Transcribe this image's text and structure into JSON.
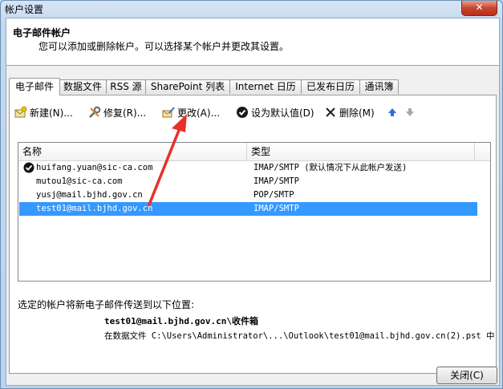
{
  "window": {
    "title": "帐户设置",
    "close_glyph": "✕"
  },
  "header": {
    "title": "电子邮件帐户",
    "description": "您可以添加或删除帐户。可以选择某个帐户并更改其设置。"
  },
  "tabs": [
    {
      "label": "电子邮件",
      "active": true
    },
    {
      "label": "数据文件",
      "active": false
    },
    {
      "label": "RSS 源",
      "active": false
    },
    {
      "label": "SharePoint 列表",
      "active": false
    },
    {
      "label": "Internet 日历",
      "active": false
    },
    {
      "label": "已发布日历",
      "active": false
    },
    {
      "label": "通讯簿",
      "active": false
    }
  ],
  "toolbar": {
    "new_label": "新建(N)...",
    "repair_label": "修复(R)...",
    "change_label": "更改(A)...",
    "default_label": "设为默认值(D)",
    "delete_label": "删除(M)"
  },
  "list": {
    "columns": [
      "名称",
      "类型"
    ],
    "rows": [
      {
        "name": "huifang.yuan@sic-ca.com",
        "type": "IMAP/SMTP (默认情况下从此帐户发送)",
        "default": true,
        "selected": false
      },
      {
        "name": "mutou1@sic-ca.com",
        "type": "IMAP/SMTP",
        "default": false,
        "selected": false
      },
      {
        "name": "yusj@mail.bjhd.gov.cn",
        "type": "POP/SMTP",
        "default": false,
        "selected": false
      },
      {
        "name": "test01@mail.bjhd.gov.cn",
        "type": "IMAP/SMTP",
        "default": false,
        "selected": true
      }
    ]
  },
  "delivery": {
    "label": "选定的帐户将新电子邮件传送到以下位置:",
    "folder": "test01@mail.bjhd.gov.cn\\收件箱",
    "file": "在数据文件 C:\\Users\\Administrator\\...\\Outlook\\test01@mail.bjhd.gov.cn(2).pst 中"
  },
  "footer": {
    "close_label": "关闭(C)"
  },
  "colors": {
    "selection": "#3399ff",
    "annotation_arrow": "#e8302a"
  }
}
